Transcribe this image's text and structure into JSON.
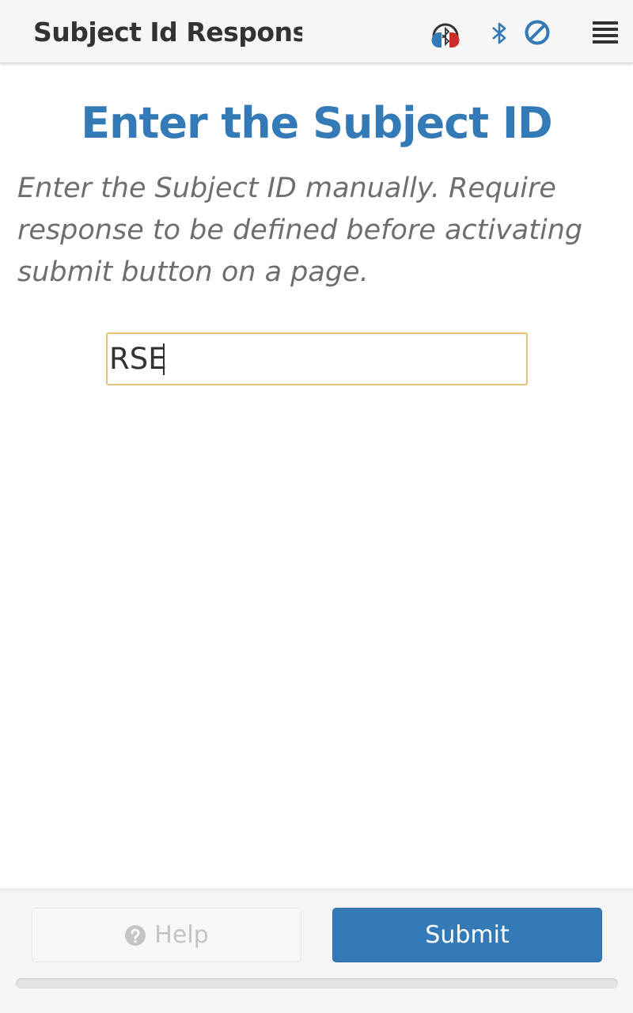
{
  "header": {
    "title": "Subject Id Response ...",
    "icons": {
      "headset": "headset-bluetooth-icon",
      "bluetooth": "bluetooth-icon",
      "block": "ban-icon",
      "menu": "menu-icon"
    }
  },
  "main": {
    "title": "Enter the Subject ID",
    "instructions": "Enter the Subject ID manually. Require response to be defined before activating submit button on a page.",
    "subject_id_value": "RSE"
  },
  "footer": {
    "help_label": "Help",
    "submit_label": "Submit",
    "progress": 0
  },
  "colors": {
    "accent": "#337ab7",
    "input_focus_border": "#e4c576",
    "headset_left": "#337ab7",
    "headset_right": "#c9302c"
  }
}
